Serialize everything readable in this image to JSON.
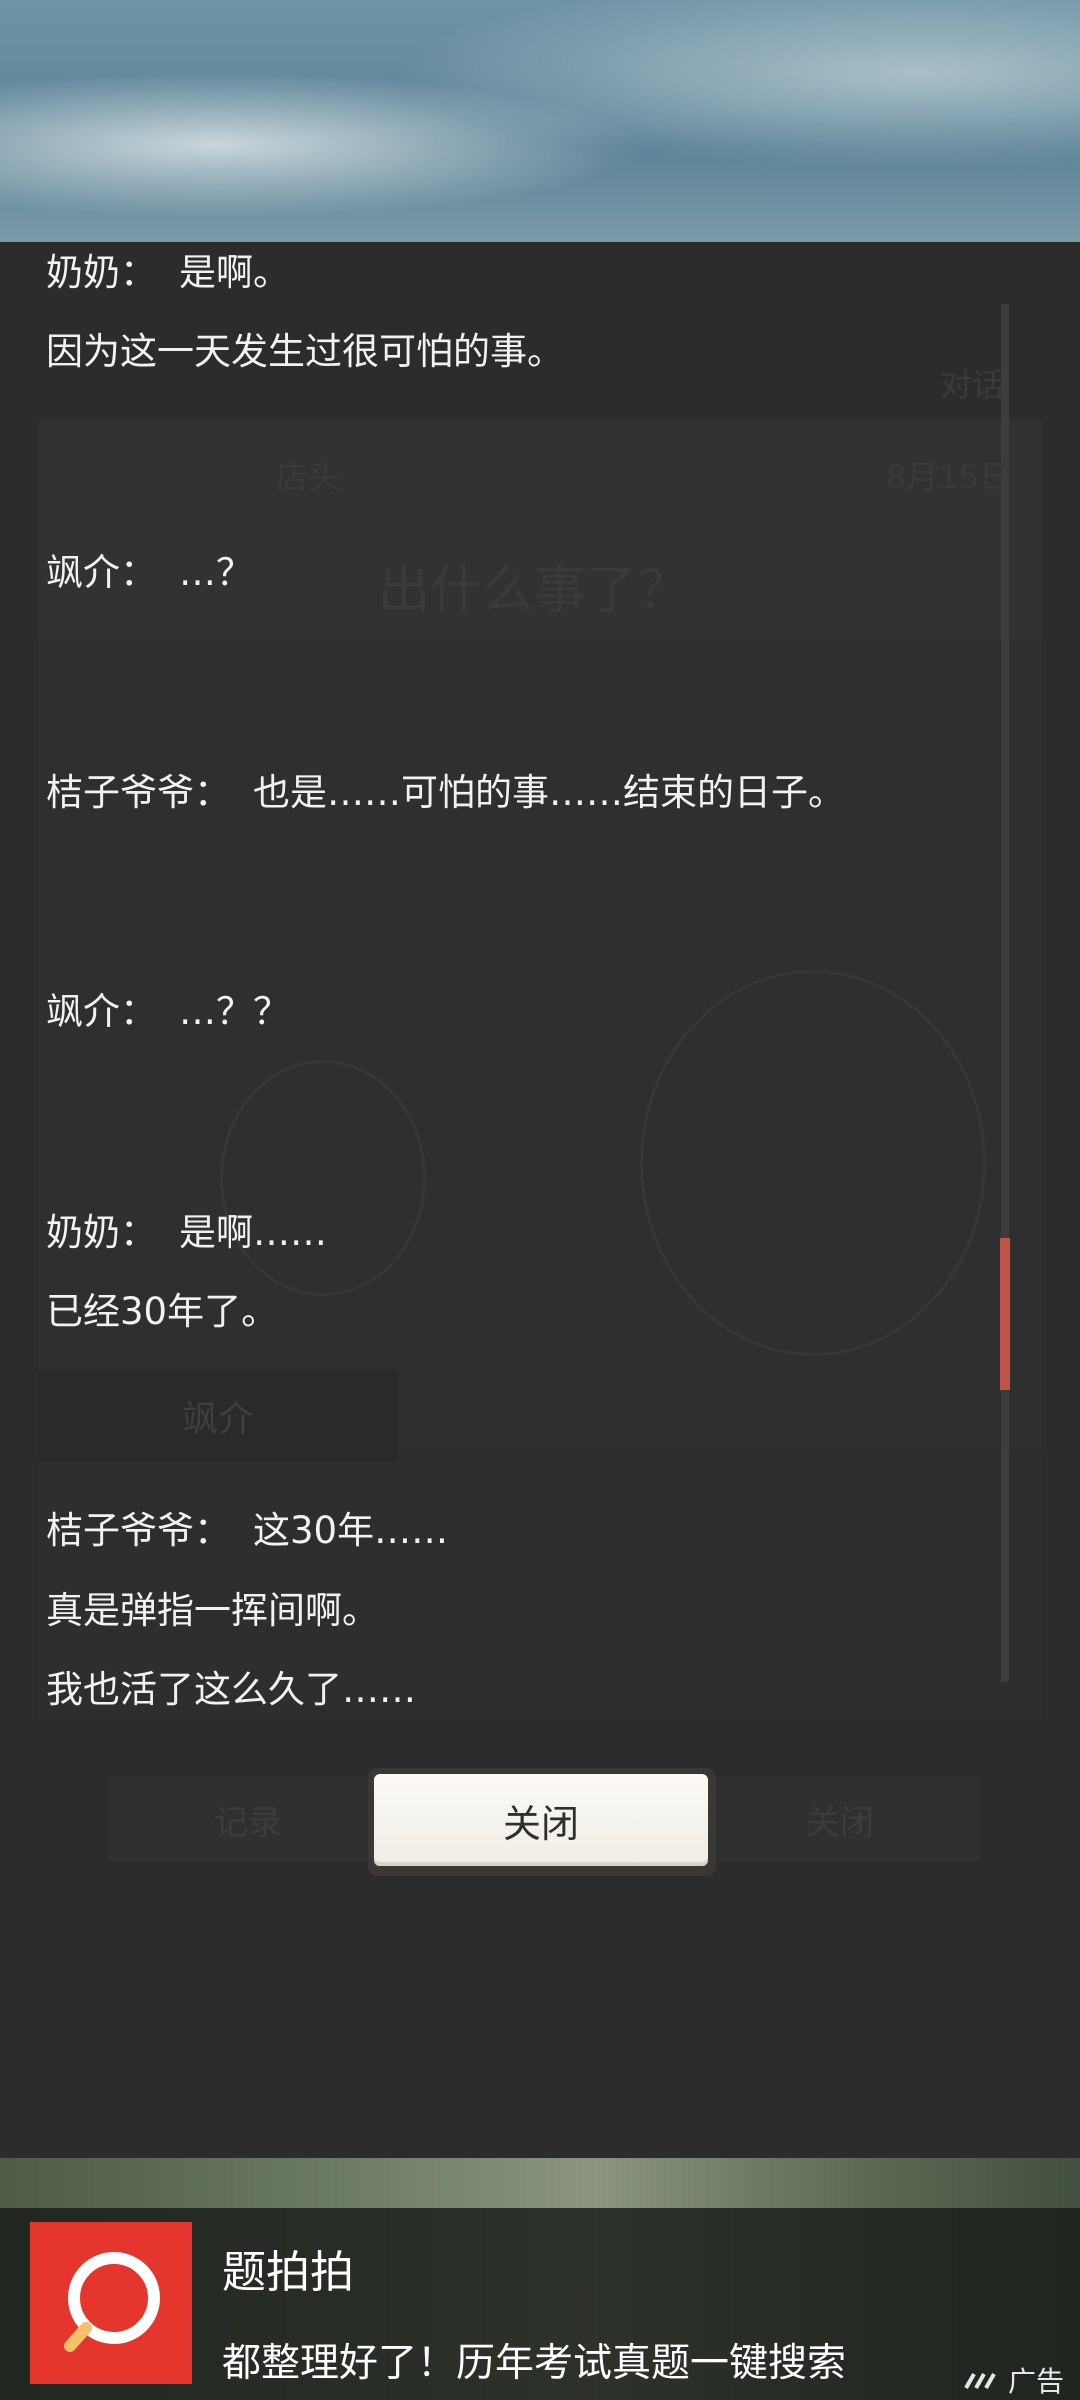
{
  "dialogue_log": [
    {
      "speaker": "奶奶：",
      "text": "是啊。"
    },
    {
      "speaker": "",
      "text": "因为这一天发生过很可怕的事。"
    },
    {
      "speaker": "飒介：",
      "text": "…？"
    },
    {
      "speaker": "桔子爷爷：",
      "text": "也是……可怕的事……结束的日子。"
    },
    {
      "speaker": "飒介：",
      "text": "…？？"
    },
    {
      "speaker": "奶奶：",
      "text": "是啊……"
    },
    {
      "speaker": "",
      "text": "已经30年了。"
    },
    {
      "speaker": "桔子爷爷：",
      "text": "这30年……"
    },
    {
      "speaker": "",
      "text": "真是弹指一挥间啊。"
    },
    {
      "speaker": "",
      "text": "我也活了这么久了……"
    }
  ],
  "close_button": {
    "label": "关闭"
  },
  "background_scene": {
    "tab_label": "对话",
    "location": "店头",
    "date": "8月15日",
    "question": "出什么事了？",
    "name_plate": "飒介",
    "left_button": "记录",
    "right_button": "关闭"
  },
  "ad": {
    "title": "题拍拍",
    "description": "都整理好了！历年考试真题一键搜索",
    "tag": "广告",
    "icon": "search-magnifier-icon",
    "icon_color": "#e4362c"
  },
  "scrollbar": {
    "thumb_color": "#c05448"
  }
}
